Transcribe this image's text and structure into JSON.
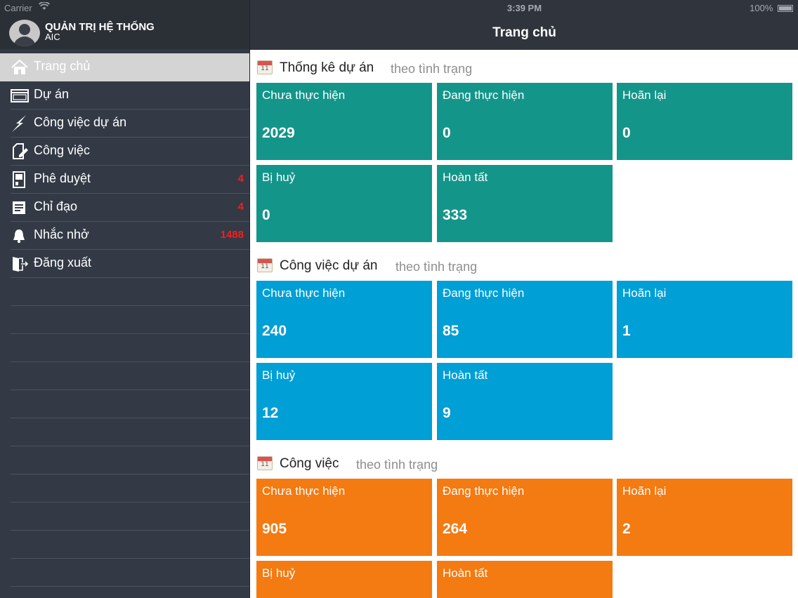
{
  "status": {
    "carrier": "Carrier",
    "time": "3:39 PM",
    "battery": "100%"
  },
  "user": {
    "name": "QUẢN TRỊ HỆ THỐNG",
    "org": "AIC"
  },
  "menu": [
    {
      "label": "Trang chủ",
      "icon": "home-icon",
      "badge": ""
    },
    {
      "label": "Dự án",
      "icon": "window-icon",
      "badge": ""
    },
    {
      "label": "Công việc dự án",
      "icon": "lightning-icon",
      "badge": ""
    },
    {
      "label": "Công việc",
      "icon": "edit-document-icon",
      "badge": ""
    },
    {
      "label": "Phê duyệt",
      "icon": "approval-icon",
      "badge": "4"
    },
    {
      "label": "Chỉ đạo",
      "icon": "list-icon",
      "badge": "4"
    },
    {
      "label": "Nhắc nhở",
      "icon": "bell-icon",
      "badge": "1488"
    },
    {
      "label": "Đăng xuất",
      "icon": "logout-icon",
      "badge": ""
    }
  ],
  "navbar": {
    "title": "Trang chủ"
  },
  "sections": [
    {
      "title": "Thống kê dự án",
      "subtitle": "theo tình trạng",
      "color": "#14958a",
      "tiles": [
        {
          "label": "Chưa thực hiện",
          "value": "2029"
        },
        {
          "label": "Đang thực hiện",
          "value": "0"
        },
        {
          "label": "Hoãn lại",
          "value": "0"
        },
        {
          "label": "Bị huỷ",
          "value": "0"
        },
        {
          "label": "Hoàn tất",
          "value": "333"
        }
      ]
    },
    {
      "title": "Công việc dự án",
      "subtitle": "theo tình trạng",
      "color": "#009fd6",
      "tiles": [
        {
          "label": "Chưa thực hiện",
          "value": "240"
        },
        {
          "label": "Đang thực hiện",
          "value": "85"
        },
        {
          "label": "Hoãn lại",
          "value": "1"
        },
        {
          "label": "Bị huỷ",
          "value": "12"
        },
        {
          "label": "Hoàn tất",
          "value": "9"
        }
      ]
    },
    {
      "title": "Công việc",
      "subtitle": "theo tình trạng",
      "color": "#f47a12",
      "tiles": [
        {
          "label": "Chưa thực hiện",
          "value": "905"
        },
        {
          "label": "Đang thực hiện",
          "value": "264"
        },
        {
          "label": "Hoãn lại",
          "value": "2"
        },
        {
          "label": "Bị huỷ",
          "value": ""
        },
        {
          "label": "Hoàn tất",
          "value": ""
        }
      ]
    }
  ],
  "calendar_icon_number": "11"
}
